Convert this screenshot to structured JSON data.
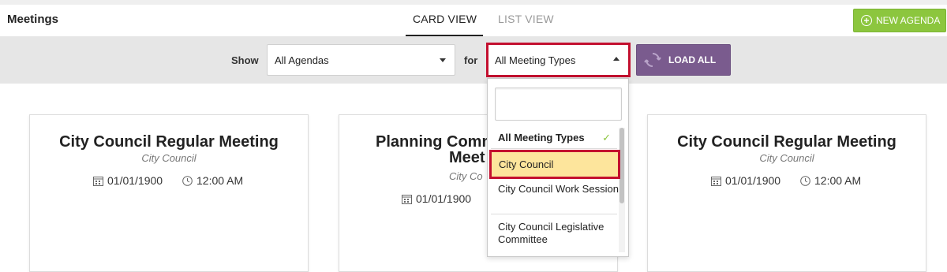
{
  "header": {
    "title": "Meetings",
    "tabs": [
      {
        "label": "CARD VIEW",
        "active": true
      },
      {
        "label": "LIST VIEW",
        "active": false
      }
    ],
    "new_agenda_label": "NEW AGENDA",
    "new_agenda_icon": "plus-circle-icon"
  },
  "filters": {
    "show_label": "Show",
    "agendas_value": "All Agendas",
    "for_label": "for",
    "types_value": "All Meeting Types",
    "load_all_label": "LOAD ALL",
    "load_all_icon": "refresh-icon"
  },
  "dropdown": {
    "search_value": "",
    "options": [
      {
        "label": "All Meeting Types",
        "selected": true
      },
      {
        "label": "City Council",
        "highlighted": true
      },
      {
        "label": "City Council Work Session"
      },
      {
        "label": "City Council Legislative Committee"
      }
    ]
  },
  "cards": [
    {
      "title": "City Council Regular Meeting",
      "subtitle": "City Council",
      "date": "01/01/1900",
      "time": "12:00 AM"
    },
    {
      "title_line1": "Planning Comm",
      "title_line2": "Meet",
      "subtitle": "City Co",
      "date": "01/01/1900"
    },
    {
      "title": "City Council Regular Meeting",
      "subtitle": "City Council",
      "date": "01/01/1900",
      "time": "12:00 AM"
    }
  ],
  "colors": {
    "new_agenda_bg": "#8cc63e",
    "load_all_bg": "#7a5b8e",
    "highlight_border": "#c3102f",
    "highlight_fill": "#fde59c"
  }
}
